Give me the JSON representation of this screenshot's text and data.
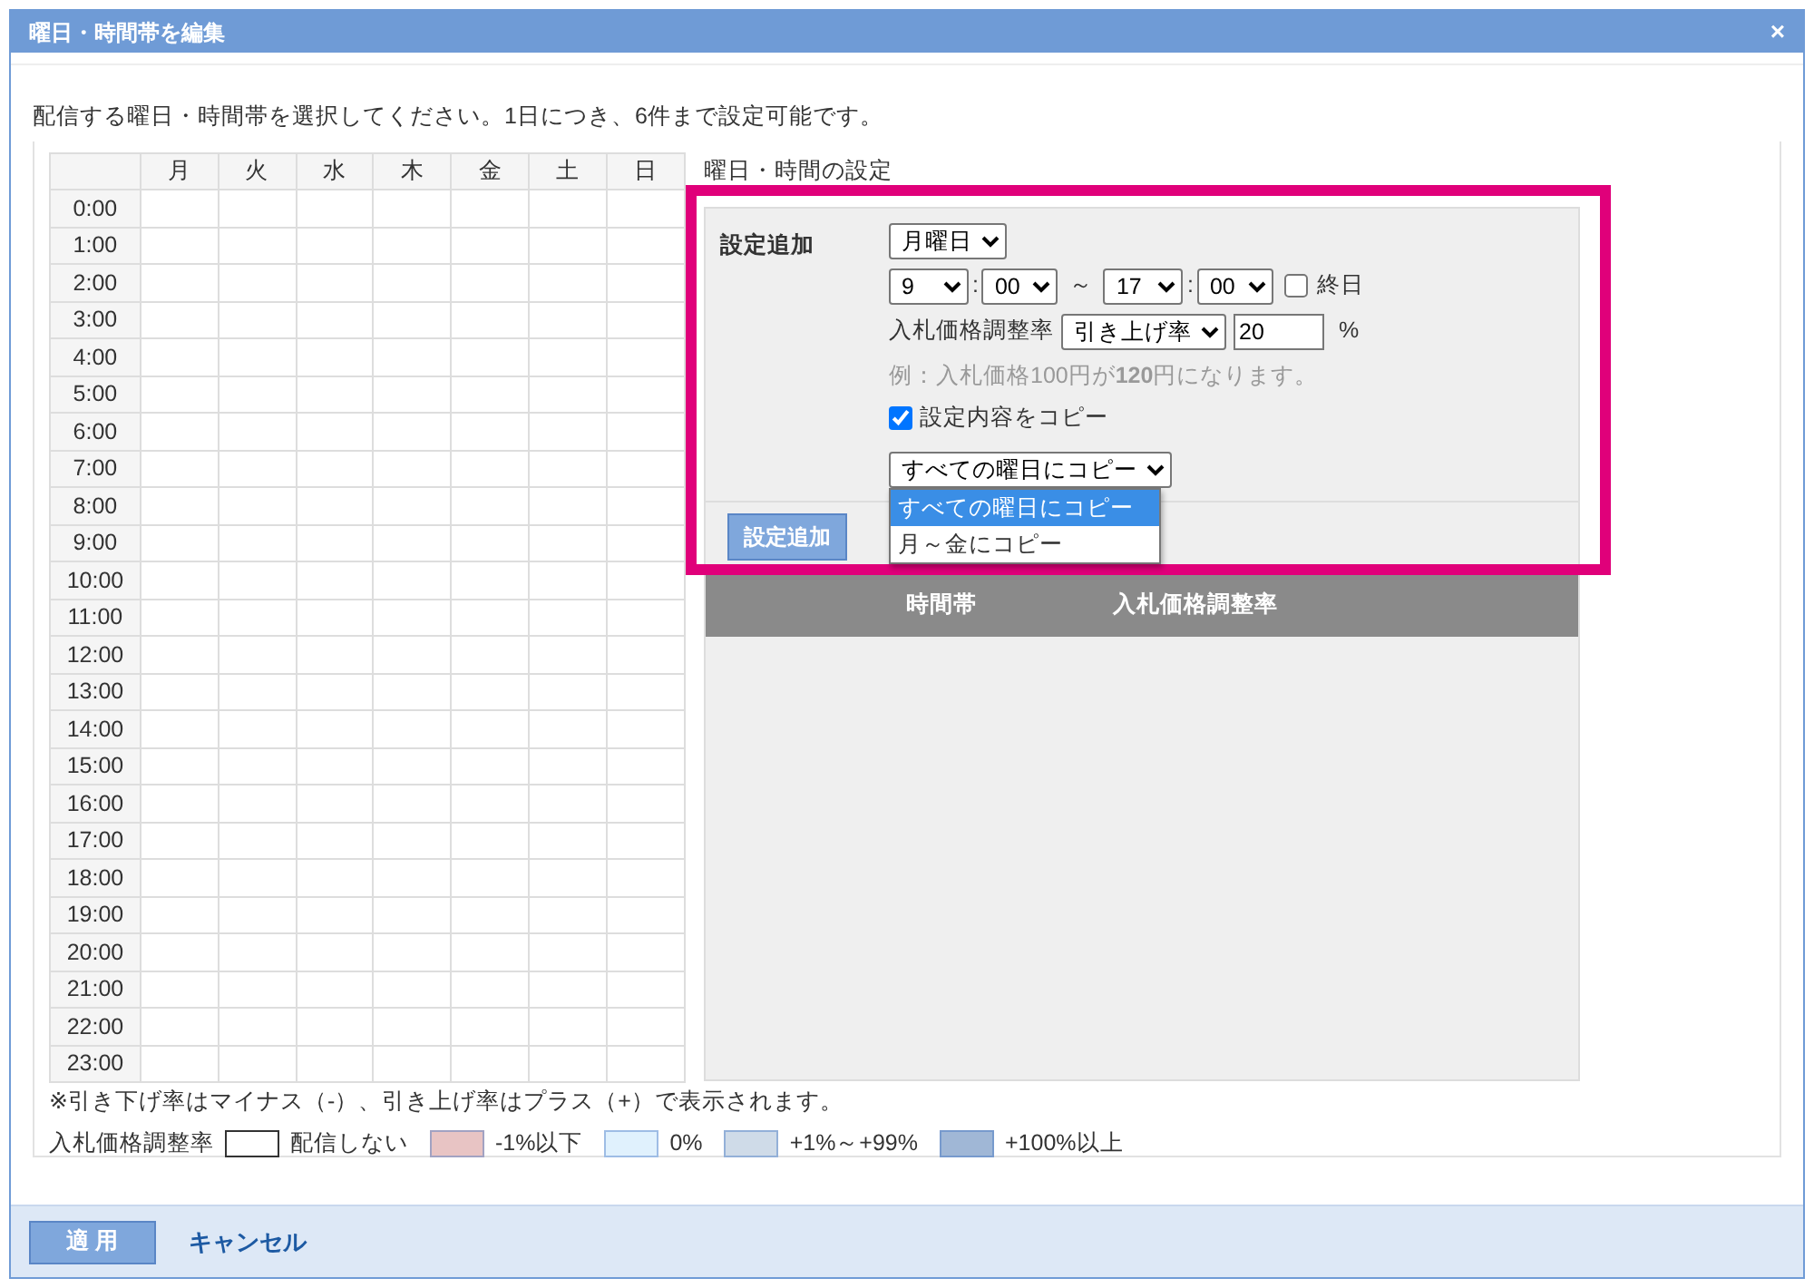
{
  "window": {
    "title": "曜日・時間帯を編集",
    "close": "×"
  },
  "instruction": "配信する曜日・時間帯を選択してください。1日につき、6件まで設定可能です。",
  "grid": {
    "columns": [
      "月",
      "火",
      "水",
      "木",
      "金",
      "土",
      "日"
    ],
    "rows": [
      "0:00",
      "1:00",
      "2:00",
      "3:00",
      "4:00",
      "5:00",
      "6:00",
      "7:00",
      "8:00",
      "9:00",
      "10:00",
      "11:00",
      "12:00",
      "13:00",
      "14:00",
      "15:00",
      "16:00",
      "17:00",
      "18:00",
      "19:00",
      "20:00",
      "21:00",
      "22:00",
      "23:00"
    ]
  },
  "settings": {
    "heading": "曜日・時間の設定",
    "label": "設定追加",
    "day": "月曜日",
    "start_hour": "9",
    "start_minute": "00",
    "range_separator": "～",
    "end_hour": "17",
    "end_minute": "00",
    "time_separator": ":",
    "all_day": {
      "label": "終日",
      "checked": false
    },
    "rate_label": "入札価格調整率",
    "rate_type": "引き上げ率",
    "rate_value": "20",
    "rate_unit": "%",
    "example": "例：入札価格100円が**120**円になります。",
    "copy": {
      "label": "設定内容をコピー",
      "checked": true
    },
    "copy_target": "すべての曜日にコピー",
    "copy_options": [
      {
        "label": "すべての曜日にコピー",
        "selected": true
      },
      {
        "label": "月～金にコピー",
        "selected": false
      }
    ],
    "add_button": "設定追加",
    "list_columns": [
      "時間帯",
      "入札価格調整率"
    ]
  },
  "note": "※引き下げ率はマイナス（-）、引き上げ率はプラス（+）で表示されます。",
  "legend": {
    "label": "入札価格調整率",
    "items": [
      {
        "label": "配信しない",
        "color": "#ffffff"
      },
      {
        "label": "-1%以下",
        "color": "#e8c4c4"
      },
      {
        "label": "0%",
        "color": "#e0f1fd"
      },
      {
        "label": "+1%～+99%",
        "color": "#cfdbe8"
      },
      {
        "label": "+100%以上",
        "color": "#a0b7d6"
      }
    ]
  },
  "footer": {
    "apply": "適 用",
    "cancel": "キャンセル"
  }
}
